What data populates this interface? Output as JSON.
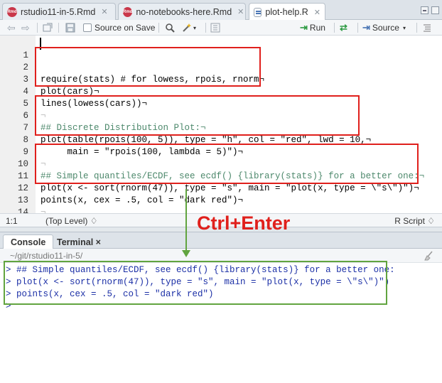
{
  "tabs": [
    {
      "label": "rstudio11-in-5.Rmd",
      "icon": "rmarkdown-file-icon",
      "active": false
    },
    {
      "label": "no-notebooks-here.Rmd",
      "icon": "rmarkdown-file-icon",
      "active": false
    },
    {
      "label": "plot-help.R",
      "icon": "r-script-file-icon",
      "active": true
    }
  ],
  "toolbar": {
    "source_on_save_label": "Source on Save",
    "source_on_save_checked": false,
    "run_label": "Run",
    "source_label": "Source"
  },
  "editor": {
    "lines": [
      {
        "num": "1",
        "text": ""
      },
      {
        "num": "2",
        "text": "require(stats) # for lowess, rpois, rnorm¬"
      },
      {
        "num": "3",
        "text": "plot(cars)¬"
      },
      {
        "num": "4",
        "text": "lines(lowess(cars))¬"
      },
      {
        "num": "5",
        "text": "¬"
      },
      {
        "num": "6",
        "text": "## Discrete Distribution Plot:¬"
      },
      {
        "num": "7",
        "text": "plot(table(rpois(100, 5)), type = \"h\", col = \"red\", lwd = 10,¬"
      },
      {
        "num": "8",
        "text": "     main = \"rpois(100, lambda = 5)\")¬"
      },
      {
        "num": "9",
        "text": "¬"
      },
      {
        "num": "10",
        "text": "## Simple quantiles/ECDF, see ecdf() {library(stats)} for a better one:¬"
      },
      {
        "num": "11",
        "text": "plot(x <- sort(rnorm(47)), type = \"s\", main = \"plot(x, type = \\\"s\\\")\")¬"
      },
      {
        "num": "12",
        "text": "points(x, cex = .5, col = \"dark red\")¬"
      },
      {
        "num": "13",
        "text": "¬"
      },
      {
        "num": "14",
        "text": "¶"
      }
    ]
  },
  "status": {
    "position": "1:1",
    "scope": "(Top Level) ♢",
    "file_type": "R Script ♢"
  },
  "annotation": {
    "label": "Ctrl+Enter"
  },
  "console": {
    "tabs": [
      {
        "label": "Console",
        "active": true
      },
      {
        "label": "Terminal ×",
        "active": false
      }
    ],
    "path": "~/git/rstudio11-in-5/",
    "lines": [
      "> ## Simple quantiles/ECDF, see ecdf() {library(stats)} for a better one:",
      "> plot(x <- sort(rnorm(47)), type = \"s\", main = \"plot(x, type = \\\"s\\\")\")",
      "> points(x, cex = .5, col = \"dark red\")",
      ">"
    ]
  },
  "colors": {
    "highlight_red": "#e0201c",
    "highlight_green": "#61a43f",
    "console_text": "#1b2fa6"
  }
}
